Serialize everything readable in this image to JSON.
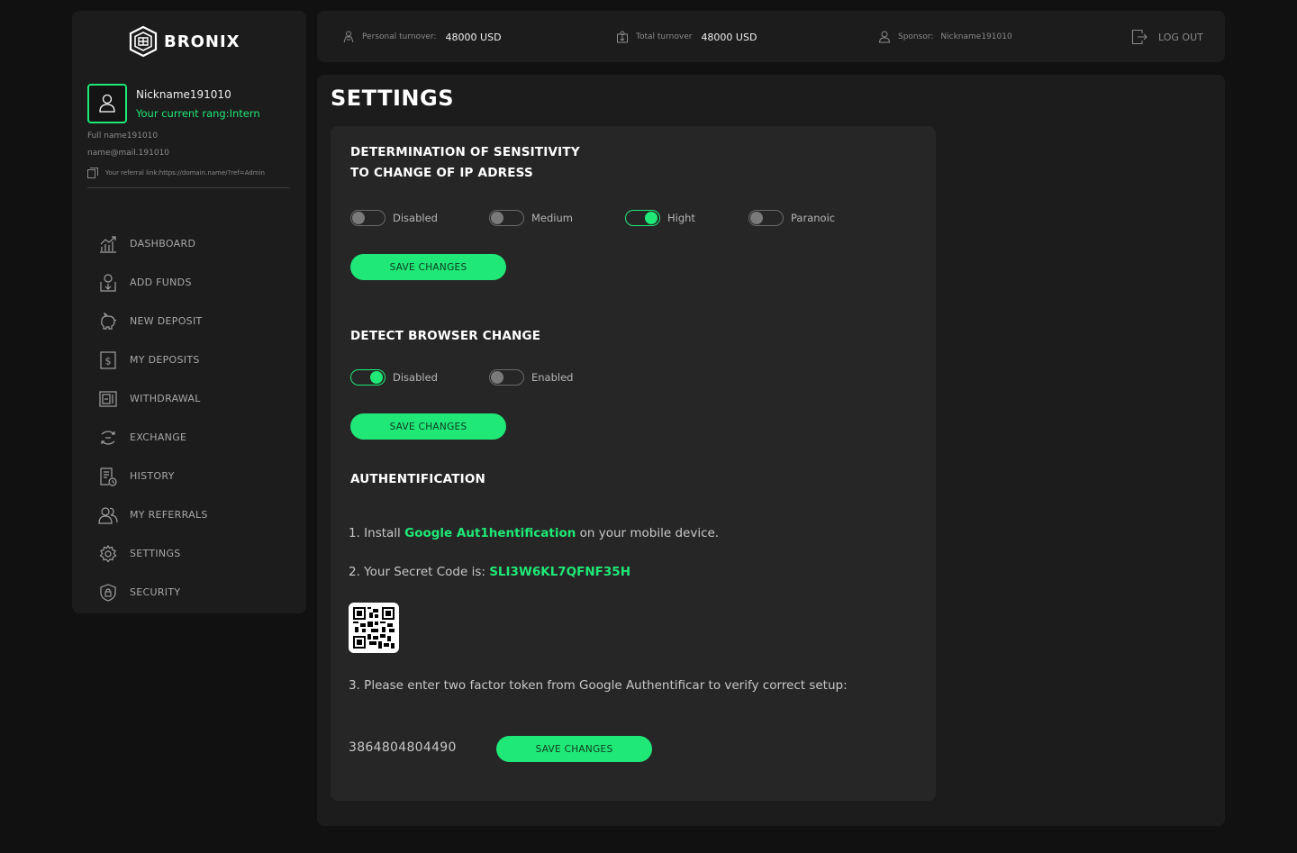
{
  "brand": {
    "name": "BRONIX",
    "accent": "#1fe877"
  },
  "user": {
    "nickname": "Nickname191010",
    "rang": "Your current rang:Intern",
    "full_name": "Full name191010",
    "email": "name@mail.191010",
    "referral_link": "Your referral link:https://domain.name/?ref=Admin"
  },
  "nav": [
    {
      "label": "DASHBOARD",
      "icon": "dashboard-chart-icon"
    },
    {
      "label": "ADD FUNDS",
      "icon": "add-funds-icon"
    },
    {
      "label": "NEW DEPOSIT",
      "icon": "piggy-bank-icon"
    },
    {
      "label": "MY DEPOSITS",
      "icon": "dollar-icon"
    },
    {
      "label": "WITHDRAWAL",
      "icon": "withdrawal-icon"
    },
    {
      "label": "EXCHANGE",
      "icon": "exchange-icon"
    },
    {
      "label": "HISTORY",
      "icon": "history-icon"
    },
    {
      "label": "MY REFERRALS",
      "icon": "referrals-icon"
    },
    {
      "label": "SETTINGS",
      "icon": "gear-icon"
    },
    {
      "label": "SECURITY",
      "icon": "shield-icon"
    }
  ],
  "topbar": {
    "personal_turnover_label": "Personal turnover:",
    "personal_turnover_value": "48000 USD",
    "total_turnover_label": "Total turnover",
    "total_turnover_value": "48000 USD",
    "sponsor_label": "Sponsor:",
    "sponsor_value": "Nickname191010",
    "logout_label": "LOG OUT"
  },
  "page_title": "SETTINGS",
  "ip_sensitivity": {
    "title_line1": "DETERMINATION OF SENSITIVITY",
    "title_line2": "TO CHANGE OF IP ADRESS",
    "options": [
      {
        "label": "Disabled",
        "on": false
      },
      {
        "label": "Medium",
        "on": false
      },
      {
        "label": "Hight",
        "on": true
      },
      {
        "label": "Paranoic",
        "on": false
      }
    ],
    "save_label": "SAVE CHANGES"
  },
  "browser_change": {
    "title": "DETECT BROWSER CHANGE",
    "options": [
      {
        "label": "Disabled",
        "on": true
      },
      {
        "label": "Enabled",
        "on": false
      }
    ],
    "save_label": "SAVE CHANGES"
  },
  "auth": {
    "title": "AUTHENTIFICATION",
    "step1_prefix": "1. Install ",
    "step1_highlight": "Google Aut1hentification",
    "step1_suffix": " on your mobile device.",
    "step2_prefix": "2. Your Secret Code is: ",
    "step2_code": "SLI3W6KL7QFNF35H",
    "step3": "3. Please enter two factor token from Google Authentificar to verify correct setup:",
    "token": "3864804804490",
    "save_label": "SAVE CHANGES"
  }
}
